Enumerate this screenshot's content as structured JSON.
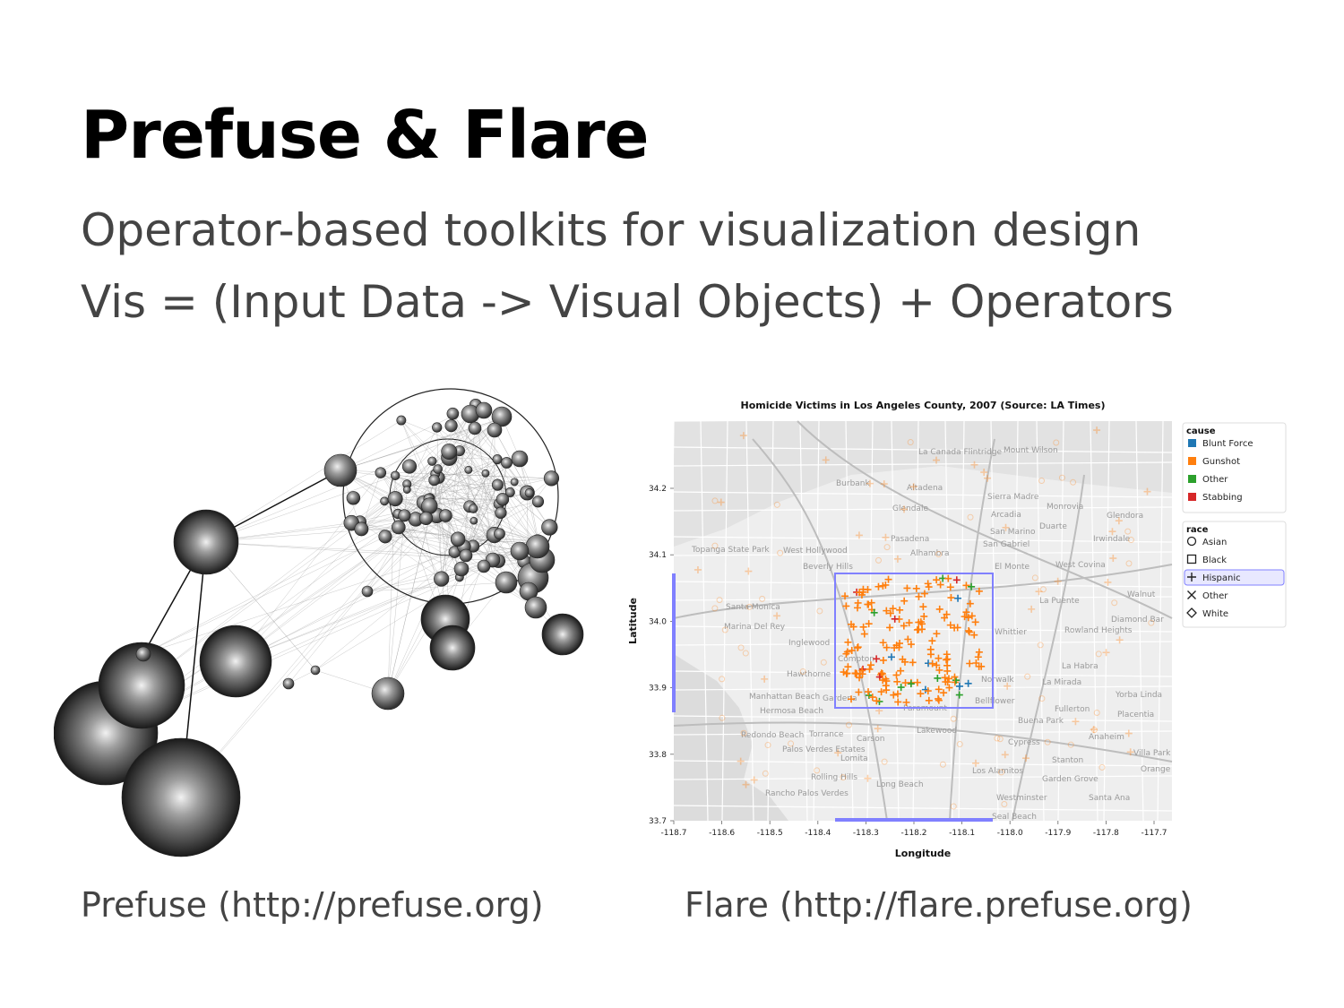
{
  "slide": {
    "title": "Prefuse & Flare",
    "subtitle_lines": [
      "Operator-based toolkits for visualization design",
      "Vis = (Input Data -> Visual Objects) + Operators"
    ],
    "captions": {
      "left": "Prefuse  (http://prefuse.org)",
      "right": "Flare  (http://flare.prefuse.org)"
    }
  },
  "flare_chart": {
    "title": "Homicide Victims in Los Angeles County, 2007 (Source: LA Times)",
    "xlabel": "Longitude",
    "ylabel": "Latitude",
    "x_ticks": [
      "-118.7",
      "-118.6",
      "-118.5",
      "-118.4",
      "-118.3",
      "-118.2",
      "-118.1",
      "-118.0",
      "-117.9",
      "-117.8",
      "-117.7"
    ],
    "y_ticks": [
      "34.2",
      "34.1",
      "34.0",
      "33.9",
      "33.8",
      "33.7"
    ],
    "legend_cause": {
      "title": "cause",
      "items": [
        {
          "label": "Blunt Force",
          "color": "#1f77b4"
        },
        {
          "label": "Gunshot",
          "color": "#ff7f0e"
        },
        {
          "label": "Other",
          "color": "#2ca02c"
        },
        {
          "label": "Stabbing",
          "color": "#d62728"
        }
      ]
    },
    "legend_race": {
      "title": "race",
      "items": [
        {
          "label": "Asian",
          "shape": "circle"
        },
        {
          "label": "Black",
          "shape": "square"
        },
        {
          "label": "Hispanic",
          "shape": "plus",
          "selected": true
        },
        {
          "label": "Other",
          "shape": "cross"
        },
        {
          "label": "White",
          "shape": "diamond"
        }
      ]
    },
    "map_labels": [
      "La Canada Flintridge",
      "Burbank",
      "Altadena",
      "Sierra Madre",
      "Monrovia",
      "Glendora",
      "Arcadia",
      "Duarte",
      "Glendale",
      "Pasadena",
      "San Marino",
      "San Gabriel",
      "West Hollywood",
      "Beverly Hills",
      "Alhambra",
      "El Monte",
      "West Covina",
      "Santa Monica",
      "Marina Del Rey",
      "Inglewood",
      "Whittier",
      "La Puente",
      "Rowland Heights",
      "Walnut",
      "Diamond Bar",
      "Hawthorne",
      "Compton",
      "Norwalk",
      "La Habra",
      "La Mirada",
      "Manhattan Beach",
      "Hermosa Beach",
      "Gardena",
      "Paramount",
      "Bellflower",
      "Buena Park",
      "Fullerton",
      "Yorba Linda",
      "Placentia",
      "Redondo Beach",
      "Torrance",
      "Carson",
      "Lakewood",
      "Cypress",
      "Anaheim",
      "Villa Park",
      "Palos Verdes Estates",
      "Lomita",
      "Stanton",
      "Orange",
      "Rolling Hills",
      "Long Beach",
      "Los Alamitos",
      "Garden Grove",
      "Rancho Palos Verdes",
      "Westminster",
      "Santa Ana",
      "Seal Beach",
      "Topanga State Park",
      "Irwindale",
      "Mount Wilson"
    ]
  },
  "colors": {
    "title": "#000000",
    "body_text": "#444444",
    "selection": "#8080ff",
    "gunshot": "#ff7f0e"
  }
}
